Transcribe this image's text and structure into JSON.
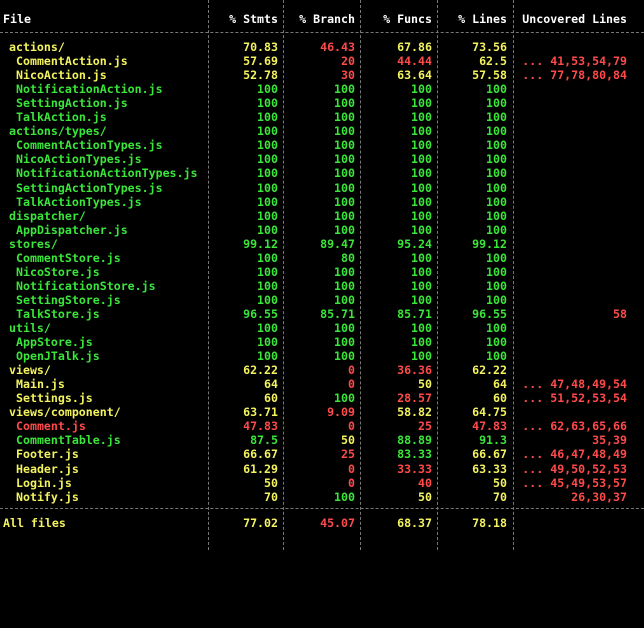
{
  "colors": {
    "high": "#3ae63a",
    "medium": "#f3f35f",
    "low": "#ff4a4a",
    "text": "#ffffff",
    "background": "#000000"
  },
  "headers": [
    "File",
    "% Stmts",
    "% Branch",
    "% Funcs",
    "% Lines",
    "Uncovered Lines"
  ],
  "rows": [
    {
      "file": "actions/",
      "indent": 1,
      "file_color": "yellow",
      "stmts": "70.83",
      "stmts_color": "yellow",
      "branch": "46.43",
      "branch_color": "red",
      "funcs": "67.86",
      "funcs_color": "yellow",
      "lines": "73.56",
      "lines_color": "yellow",
      "uncovered": ""
    },
    {
      "file": "CommentAction.js",
      "indent": 2,
      "file_color": "yellow",
      "stmts": "57.69",
      "stmts_color": "yellow",
      "branch": "20",
      "branch_color": "red",
      "funcs": "44.44",
      "funcs_color": "red",
      "lines": "62.5",
      "lines_color": "yellow",
      "uncovered": "... 41,53,54,79"
    },
    {
      "file": "NicoAction.js",
      "indent": 2,
      "file_color": "yellow",
      "stmts": "52.78",
      "stmts_color": "yellow",
      "branch": "30",
      "branch_color": "red",
      "funcs": "63.64",
      "funcs_color": "yellow",
      "lines": "57.58",
      "lines_color": "yellow",
      "uncovered": "... 77,78,80,84"
    },
    {
      "file": "NotificationAction.js",
      "indent": 2,
      "file_color": "green",
      "stmts": "100",
      "stmts_color": "green",
      "branch": "100",
      "branch_color": "green",
      "funcs": "100",
      "funcs_color": "green",
      "lines": "100",
      "lines_color": "green",
      "uncovered": ""
    },
    {
      "file": "SettingAction.js",
      "indent": 2,
      "file_color": "green",
      "stmts": "100",
      "stmts_color": "green",
      "branch": "100",
      "branch_color": "green",
      "funcs": "100",
      "funcs_color": "green",
      "lines": "100",
      "lines_color": "green",
      "uncovered": ""
    },
    {
      "file": "TalkAction.js",
      "indent": 2,
      "file_color": "green",
      "stmts": "100",
      "stmts_color": "green",
      "branch": "100",
      "branch_color": "green",
      "funcs": "100",
      "funcs_color": "green",
      "lines": "100",
      "lines_color": "green",
      "uncovered": ""
    },
    {
      "file": "actions/types/",
      "indent": 1,
      "file_color": "green",
      "stmts": "100",
      "stmts_color": "green",
      "branch": "100",
      "branch_color": "green",
      "funcs": "100",
      "funcs_color": "green",
      "lines": "100",
      "lines_color": "green",
      "uncovered": ""
    },
    {
      "file": "CommentActionTypes.js",
      "indent": 2,
      "file_color": "green",
      "stmts": "100",
      "stmts_color": "green",
      "branch": "100",
      "branch_color": "green",
      "funcs": "100",
      "funcs_color": "green",
      "lines": "100",
      "lines_color": "green",
      "uncovered": ""
    },
    {
      "file": "NicoActionTypes.js",
      "indent": 2,
      "file_color": "green",
      "stmts": "100",
      "stmts_color": "green",
      "branch": "100",
      "branch_color": "green",
      "funcs": "100",
      "funcs_color": "green",
      "lines": "100",
      "lines_color": "green",
      "uncovered": ""
    },
    {
      "file": "NotificationActionTypes.js",
      "indent": 2,
      "file_color": "green",
      "stmts": "100",
      "stmts_color": "green",
      "branch": "100",
      "branch_color": "green",
      "funcs": "100",
      "funcs_color": "green",
      "lines": "100",
      "lines_color": "green",
      "uncovered": ""
    },
    {
      "file": "SettingActionTypes.js",
      "indent": 2,
      "file_color": "green",
      "stmts": "100",
      "stmts_color": "green",
      "branch": "100",
      "branch_color": "green",
      "funcs": "100",
      "funcs_color": "green",
      "lines": "100",
      "lines_color": "green",
      "uncovered": ""
    },
    {
      "file": "TalkActionTypes.js",
      "indent": 2,
      "file_color": "green",
      "stmts": "100",
      "stmts_color": "green",
      "branch": "100",
      "branch_color": "green",
      "funcs": "100",
      "funcs_color": "green",
      "lines": "100",
      "lines_color": "green",
      "uncovered": ""
    },
    {
      "file": "dispatcher/",
      "indent": 1,
      "file_color": "green",
      "stmts": "100",
      "stmts_color": "green",
      "branch": "100",
      "branch_color": "green",
      "funcs": "100",
      "funcs_color": "green",
      "lines": "100",
      "lines_color": "green",
      "uncovered": ""
    },
    {
      "file": "AppDispatcher.js",
      "indent": 2,
      "file_color": "green",
      "stmts": "100",
      "stmts_color": "green",
      "branch": "100",
      "branch_color": "green",
      "funcs": "100",
      "funcs_color": "green",
      "lines": "100",
      "lines_color": "green",
      "uncovered": ""
    },
    {
      "file": "stores/",
      "indent": 1,
      "file_color": "green",
      "stmts": "99.12",
      "stmts_color": "green",
      "branch": "89.47",
      "branch_color": "green",
      "funcs": "95.24",
      "funcs_color": "green",
      "lines": "99.12",
      "lines_color": "green",
      "uncovered": ""
    },
    {
      "file": "CommentStore.js",
      "indent": 2,
      "file_color": "green",
      "stmts": "100",
      "stmts_color": "green",
      "branch": "80",
      "branch_color": "green",
      "funcs": "100",
      "funcs_color": "green",
      "lines": "100",
      "lines_color": "green",
      "uncovered": ""
    },
    {
      "file": "NicoStore.js",
      "indent": 2,
      "file_color": "green",
      "stmts": "100",
      "stmts_color": "green",
      "branch": "100",
      "branch_color": "green",
      "funcs": "100",
      "funcs_color": "green",
      "lines": "100",
      "lines_color": "green",
      "uncovered": ""
    },
    {
      "file": "NotificationStore.js",
      "indent": 2,
      "file_color": "green",
      "stmts": "100",
      "stmts_color": "green",
      "branch": "100",
      "branch_color": "green",
      "funcs": "100",
      "funcs_color": "green",
      "lines": "100",
      "lines_color": "green",
      "uncovered": ""
    },
    {
      "file": "SettingStore.js",
      "indent": 2,
      "file_color": "green",
      "stmts": "100",
      "stmts_color": "green",
      "branch": "100",
      "branch_color": "green",
      "funcs": "100",
      "funcs_color": "green",
      "lines": "100",
      "lines_color": "green",
      "uncovered": ""
    },
    {
      "file": "TalkStore.js",
      "indent": 2,
      "file_color": "green",
      "stmts": "96.55",
      "stmts_color": "green",
      "branch": "85.71",
      "branch_color": "green",
      "funcs": "85.71",
      "funcs_color": "green",
      "lines": "96.55",
      "lines_color": "green",
      "uncovered": "58"
    },
    {
      "file": "utils/",
      "indent": 1,
      "file_color": "green",
      "stmts": "100",
      "stmts_color": "green",
      "branch": "100",
      "branch_color": "green",
      "funcs": "100",
      "funcs_color": "green",
      "lines": "100",
      "lines_color": "green",
      "uncovered": ""
    },
    {
      "file": "AppStore.js",
      "indent": 2,
      "file_color": "green",
      "stmts": "100",
      "stmts_color": "green",
      "branch": "100",
      "branch_color": "green",
      "funcs": "100",
      "funcs_color": "green",
      "lines": "100",
      "lines_color": "green",
      "uncovered": ""
    },
    {
      "file": "OpenJTalk.js",
      "indent": 2,
      "file_color": "green",
      "stmts": "100",
      "stmts_color": "green",
      "branch": "100",
      "branch_color": "green",
      "funcs": "100",
      "funcs_color": "green",
      "lines": "100",
      "lines_color": "green",
      "uncovered": ""
    },
    {
      "file": "views/",
      "indent": 1,
      "file_color": "yellow",
      "stmts": "62.22",
      "stmts_color": "yellow",
      "branch": "0",
      "branch_color": "red",
      "funcs": "36.36",
      "funcs_color": "red",
      "lines": "62.22",
      "lines_color": "yellow",
      "uncovered": ""
    },
    {
      "file": "Main.js",
      "indent": 2,
      "file_color": "yellow",
      "stmts": "64",
      "stmts_color": "yellow",
      "branch": "0",
      "branch_color": "red",
      "funcs": "50",
      "funcs_color": "yellow",
      "lines": "64",
      "lines_color": "yellow",
      "uncovered": "... 47,48,49,54"
    },
    {
      "file": "Settings.js",
      "indent": 2,
      "file_color": "yellow",
      "stmts": "60",
      "stmts_color": "yellow",
      "branch": "100",
      "branch_color": "green",
      "funcs": "28.57",
      "funcs_color": "red",
      "lines": "60",
      "lines_color": "yellow",
      "uncovered": "... 51,52,53,54"
    },
    {
      "file": "views/component/",
      "indent": 1,
      "file_color": "yellow",
      "stmts": "63.71",
      "stmts_color": "yellow",
      "branch": "9.09",
      "branch_color": "red",
      "funcs": "58.82",
      "funcs_color": "yellow",
      "lines": "64.75",
      "lines_color": "yellow",
      "uncovered": ""
    },
    {
      "file": "Comment.js",
      "indent": 2,
      "file_color": "red",
      "stmts": "47.83",
      "stmts_color": "red",
      "branch": "0",
      "branch_color": "red",
      "funcs": "25",
      "funcs_color": "red",
      "lines": "47.83",
      "lines_color": "red",
      "uncovered": "... 62,63,65,66"
    },
    {
      "file": "CommentTable.js",
      "indent": 2,
      "file_color": "green",
      "stmts": "87.5",
      "stmts_color": "green",
      "branch": "50",
      "branch_color": "yellow",
      "funcs": "88.89",
      "funcs_color": "green",
      "lines": "91.3",
      "lines_color": "green",
      "uncovered": "35,39"
    },
    {
      "file": "Footer.js",
      "indent": 2,
      "file_color": "yellow",
      "stmts": "66.67",
      "stmts_color": "yellow",
      "branch": "25",
      "branch_color": "red",
      "funcs": "83.33",
      "funcs_color": "green",
      "lines": "66.67",
      "lines_color": "yellow",
      "uncovered": "... 46,47,48,49"
    },
    {
      "file": "Header.js",
      "indent": 2,
      "file_color": "yellow",
      "stmts": "61.29",
      "stmts_color": "yellow",
      "branch": "0",
      "branch_color": "red",
      "funcs": "33.33",
      "funcs_color": "red",
      "lines": "63.33",
      "lines_color": "yellow",
      "uncovered": "... 49,50,52,53"
    },
    {
      "file": "Login.js",
      "indent": 2,
      "file_color": "yellow",
      "stmts": "50",
      "stmts_color": "yellow",
      "branch": "0",
      "branch_color": "red",
      "funcs": "40",
      "funcs_color": "red",
      "lines": "50",
      "lines_color": "yellow",
      "uncovered": "... 45,49,53,57"
    },
    {
      "file": "Notify.js",
      "indent": 2,
      "file_color": "yellow",
      "stmts": "70",
      "stmts_color": "yellow",
      "branch": "100",
      "branch_color": "green",
      "funcs": "50",
      "funcs_color": "yellow",
      "lines": "70",
      "lines_color": "yellow",
      "uncovered": "26,30,37"
    }
  ],
  "summary": {
    "file": "All files",
    "file_color": "yellow",
    "stmts": "77.02",
    "stmts_color": "yellow",
    "branch": "45.07",
    "branch_color": "red",
    "funcs": "68.37",
    "funcs_color": "yellow",
    "lines": "78.18",
    "lines_color": "yellow",
    "uncovered": ""
  }
}
